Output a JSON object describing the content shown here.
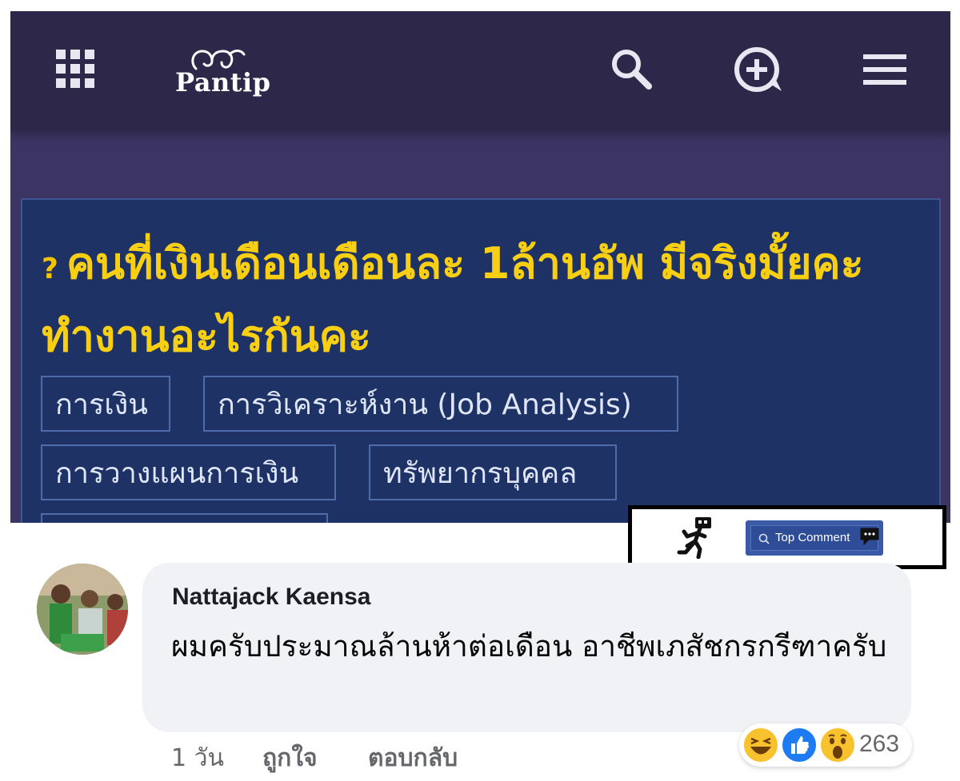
{
  "header": {
    "logo_text": "Pantip",
    "icons": [
      "apps-grid-icon",
      "search-icon",
      "new-topic-icon",
      "menu-icon"
    ],
    "colors": {
      "topbar": "#2d2749",
      "background": "#3c3563"
    }
  },
  "topic": {
    "title": "คนที่เงินเดือนเดือนละ 1ล้านอัพ มีจริงมั้ยคะ ทำงานอะไรกันคะ",
    "question_mark": "?",
    "tags": [
      "การเงิน",
      "การวิเคราะห์งาน (Job Analysis)",
      "การวางแผนการเงิน",
      "ทรัพยากรบุคคล"
    ],
    "colors": {
      "card": "#1e3266",
      "title": "#f8cf13"
    }
  },
  "top_comment_badge": {
    "label": "Top Comment"
  },
  "comment": {
    "author": "Nattajack Kaensa",
    "text": "ผมครับประมาณล้านห้าต่อเดือน อาชีพเภสัชกรกรีฑาครับ",
    "time": "1 วัน",
    "like_action": "ถูกใจ",
    "reply_action": "ตอบกลับ",
    "reaction_count": "263",
    "reactions": [
      "haha-icon",
      "like-icon",
      "wow-icon"
    ]
  }
}
